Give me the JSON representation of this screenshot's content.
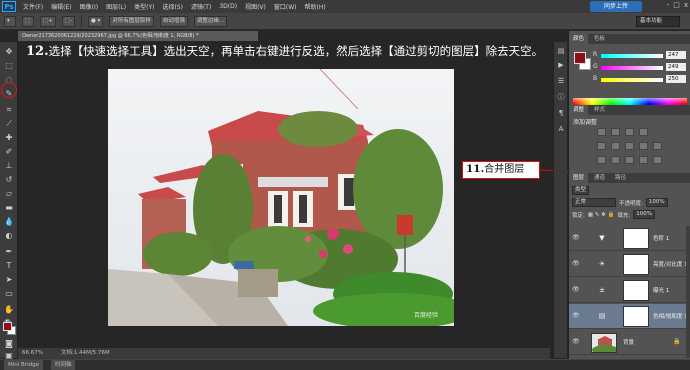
{
  "app": {
    "logo": "Ps"
  },
  "menu": [
    "文件(F)",
    "编辑(E)",
    "图像(I)",
    "图层(L)",
    "类型(Y)",
    "选择(S)",
    "滤镜(T)",
    "3D(D)",
    "视图(V)",
    "窗口(W)",
    "帮助(H)"
  ],
  "sync_button": "同步上传",
  "window_controls": [
    "-",
    "□",
    "x"
  ],
  "options": {
    "auto_enhance": "自动增强",
    "sample_all": "对所有图层取样",
    "refine_edge": "调整边缘...",
    "workspace": "基本功能"
  },
  "document_tab": "Owner2173620061229/20232967.jpg @ 66.7%(色相/饱和度 1, RGB/8) *",
  "instruction": {
    "step": "12.",
    "text": "选择【快速选择工具】选出天空，再单击右键进行反选，然后选择【通过剪切的图层】除去天空。"
  },
  "callout": {
    "step": "11.",
    "text": "合并图层"
  },
  "watermark": "百度经验",
  "status": {
    "zoom": "66.67%",
    "info": "文档:1.44M/5.76M"
  },
  "bottom_tabs": [
    "Mini Bridge",
    "时间轴"
  ],
  "color_panel": {
    "tabs": [
      "颜色",
      "色板"
    ],
    "channels": [
      {
        "label": "R",
        "value": "247"
      },
      {
        "label": "G",
        "value": "249"
      },
      {
        "label": "B",
        "value": "250"
      }
    ],
    "fg_color": "#8e0f17",
    "bg_color": "#ffffff"
  },
  "adjustments": {
    "tabs": [
      "调整",
      "样式"
    ],
    "title": "添加调整"
  },
  "layers": {
    "tabs": [
      "图层",
      "通道",
      "路径"
    ],
    "filter": "类型",
    "blend_mode": "正常",
    "opacity_label": "不透明度:",
    "opacity": "100%",
    "lock_label": "锁定:",
    "fill_label": "填充:",
    "fill": "100%",
    "items": [
      {
        "name": "色阶 1",
        "adj_icon": "▼",
        "icon_name": "levels-icon"
      },
      {
        "name": "亮度/对比度 1",
        "adj_icon": "☀",
        "icon_name": "brightness-icon"
      },
      {
        "name": "曝光 1",
        "adj_icon": "±",
        "icon_name": "exposure-icon"
      },
      {
        "name": "色相/饱和度 1",
        "adj_icon": "▤",
        "icon_name": "hue-saturation-icon"
      },
      {
        "name": "背景",
        "adj_icon": "",
        "icon_name": "background-thumb"
      }
    ]
  },
  "accent_colors": {
    "highlight": "#d31010",
    "selected_layer": "#6a7a90"
  }
}
